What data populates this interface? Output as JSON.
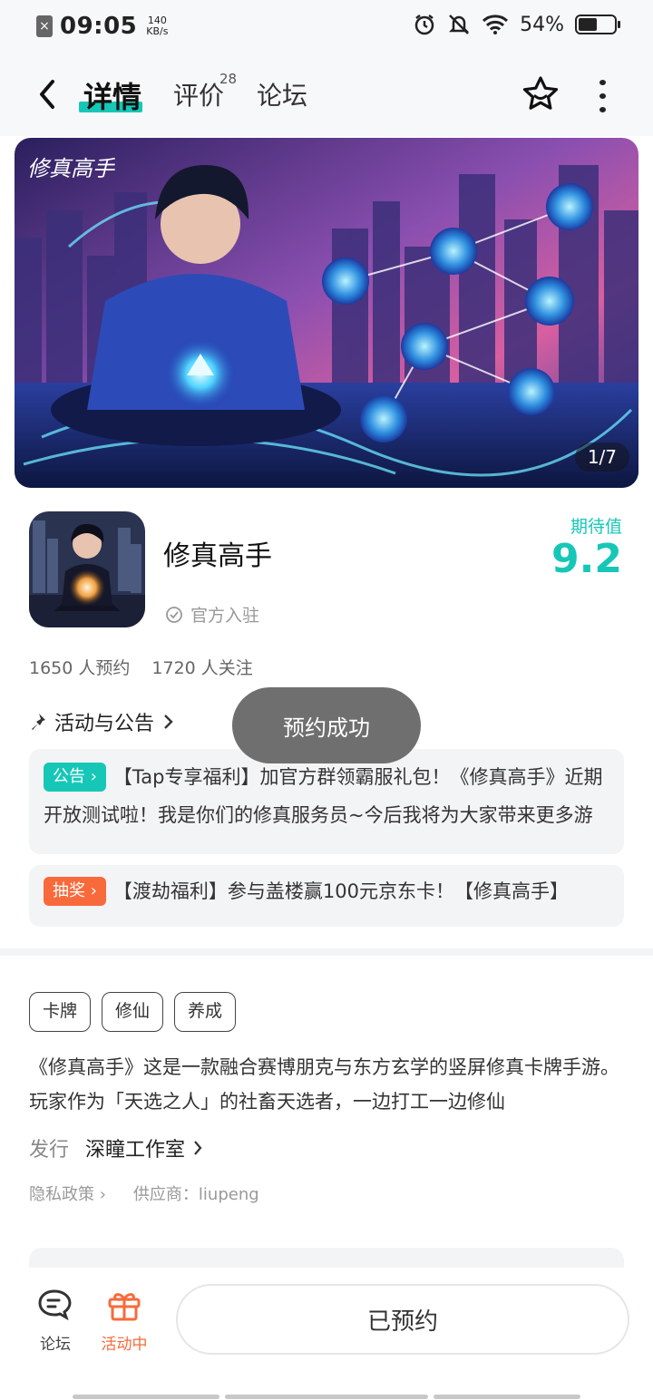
{
  "status_bar": {
    "time": "09:05",
    "speed_value": "140",
    "speed_unit": "KB/s",
    "battery_percent": "54%",
    "battery_level": 0.54
  },
  "header": {
    "tabs": [
      {
        "label": "详情"
      },
      {
        "label": "评价",
        "count": "28"
      },
      {
        "label": "论坛"
      }
    ]
  },
  "banner": {
    "counter": "1/7",
    "logo_text": "修真高手"
  },
  "app": {
    "name": "修真高手",
    "official": "官方入驻",
    "expect_label": "期待值",
    "expect_value": "9.2",
    "reservations": "1650 人预约",
    "followers": "1720 人关注"
  },
  "activities": {
    "title": "活动与公告",
    "items": [
      {
        "badge": "公告",
        "text": "【Tap专享福利】加官方群领霸服礼包！《修真高手》近期开放测试啦！我是你们的修真服务员~今后我将为大家带来更多游戏资讯"
      },
      {
        "badge": "抽奖",
        "text": "【渡劫福利】参与盖楼赢100元京东卡！【修真高手】"
      }
    ]
  },
  "tags": [
    "卡牌",
    "修仙",
    "养成"
  ],
  "description": "《修真高手》这是一款融合赛博朋克与东方玄学的竖屏修真卡牌手游。玩家作为「天选之人」的社畜天选者，一边打工一边修仙",
  "publisher": {
    "label": "发行",
    "name": "深瞳工作室"
  },
  "policy": {
    "privacy": "隐私政策",
    "supplier": "供应商：liupeng"
  },
  "bottom_bar": {
    "forum": "论坛",
    "activity": "活动中",
    "reserved": "已预约"
  },
  "toast": "预约成功",
  "colors": {
    "accent": "#16c7b7",
    "orange": "#f86a3b"
  }
}
